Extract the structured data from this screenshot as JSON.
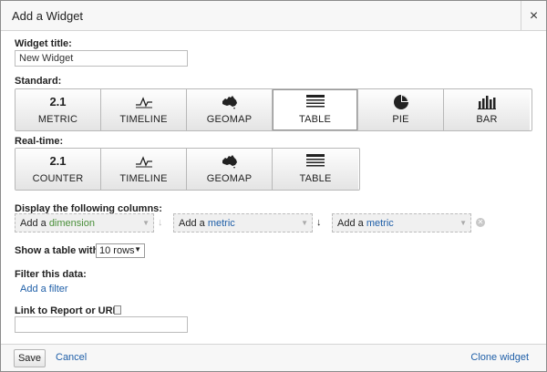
{
  "dialog": {
    "title": "Add a Widget",
    "close_symbol": "×"
  },
  "widget_title": {
    "label": "Widget title:",
    "value": "New Widget"
  },
  "standard": {
    "label": "Standard:",
    "buttons": [
      {
        "big": "2.1",
        "label": "METRIC",
        "icon": "number-icon"
      },
      {
        "label": "TIMELINE",
        "icon": "timeline-icon"
      },
      {
        "label": "GEOMAP",
        "icon": "australia-map-icon"
      },
      {
        "label": "TABLE",
        "icon": "table-icon",
        "selected": true
      },
      {
        "label": "PIE",
        "icon": "pie-icon"
      },
      {
        "label": "BAR",
        "icon": "bar-chart-icon"
      }
    ]
  },
  "realtime": {
    "label": "Real-time:",
    "buttons": [
      {
        "big": "2.1",
        "label": "COUNTER",
        "icon": "number-icon"
      },
      {
        "label": "TIMELINE",
        "icon": "timeline-icon"
      },
      {
        "label": "GEOMAP",
        "icon": "australia-map-icon"
      },
      {
        "label": "TABLE",
        "icon": "table-icon"
      }
    ]
  },
  "columns": {
    "label": "Display the following columns:",
    "dimension": {
      "prefix": "Add a ",
      "word": "dimension"
    },
    "metric1": {
      "prefix": "Add a ",
      "word": "metric"
    },
    "metric2": {
      "prefix": "Add a ",
      "word": "metric"
    },
    "arrow_symbol": "↓",
    "caret_symbol": "▼"
  },
  "table_rows": {
    "label": "Show a table with",
    "value": "10 rows"
  },
  "filter": {
    "label": "Filter this data:",
    "link": "Add a filter"
  },
  "link_report": {
    "label": "Link to Report or URL:",
    "value": ""
  },
  "footer": {
    "save": "Save",
    "cancel": "Cancel",
    "clone": "Clone widget"
  },
  "colors": {
    "link": "#1f5fa8",
    "dimension": "#4a8f3a",
    "border": "#b8b8b8"
  }
}
